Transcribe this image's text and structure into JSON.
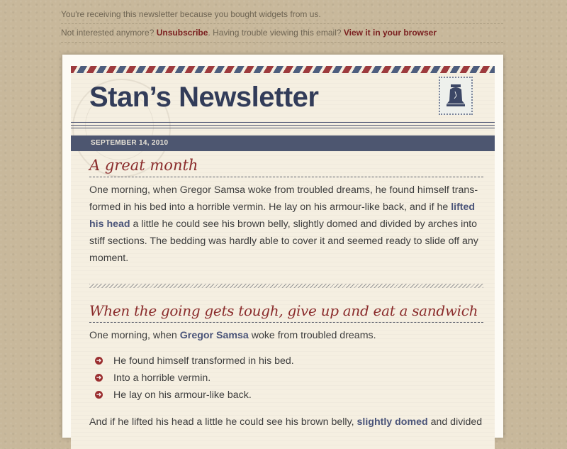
{
  "preheader": {
    "line1": "You're receiving this newsletter because you bought widgets from us.",
    "line2_prefix": "Not interested anymore?",
    "unsubscribe_label": "Unsubscribe",
    "line2_middle": ". Having trouble viewing this email?",
    "view_browser_label": "View it in your browser"
  },
  "header": {
    "title": "Stan’s Newsletter",
    "date": "SEPTEMBER 14, 2010"
  },
  "article1": {
    "heading": "A great month",
    "text_a": "One morning, when Gregor Samsa woke from troubled dreams, he found himself trans-formed in his bed into a horrible vermin. He lay on his armour-like back, and if he ",
    "bold": "lifted his head",
    "text_b": " a little he could see his brown belly, slightly domed and divided by arches into stiff sections. The bedding was hardly able to cover it and seemed ready to slide off any moment."
  },
  "article2": {
    "heading": "When the going gets tough, give up and eat a sandwich",
    "intro_a": "One morning, when ",
    "intro_bold": "Gregor Samsa",
    "intro_b": " woke from troubled dreams.",
    "bullets": [
      "He found himself transformed in his bed.",
      "Into a horrible vermin.",
      "He lay on his armour-like back."
    ],
    "closing_a": "And if he lifted his head a little he could see his brown belly, ",
    "closing_bold": "slightly domed",
    "closing_b": " and divided"
  },
  "colors": {
    "heading_red": "#8a2b2b",
    "title_navy": "#323c59",
    "link_maroon": "#7a1f1f",
    "date_bar": "#4d5670"
  },
  "icons": {
    "bullet": "arrow-circle-icon",
    "stamp": "liberty-bell-stamp-icon"
  }
}
